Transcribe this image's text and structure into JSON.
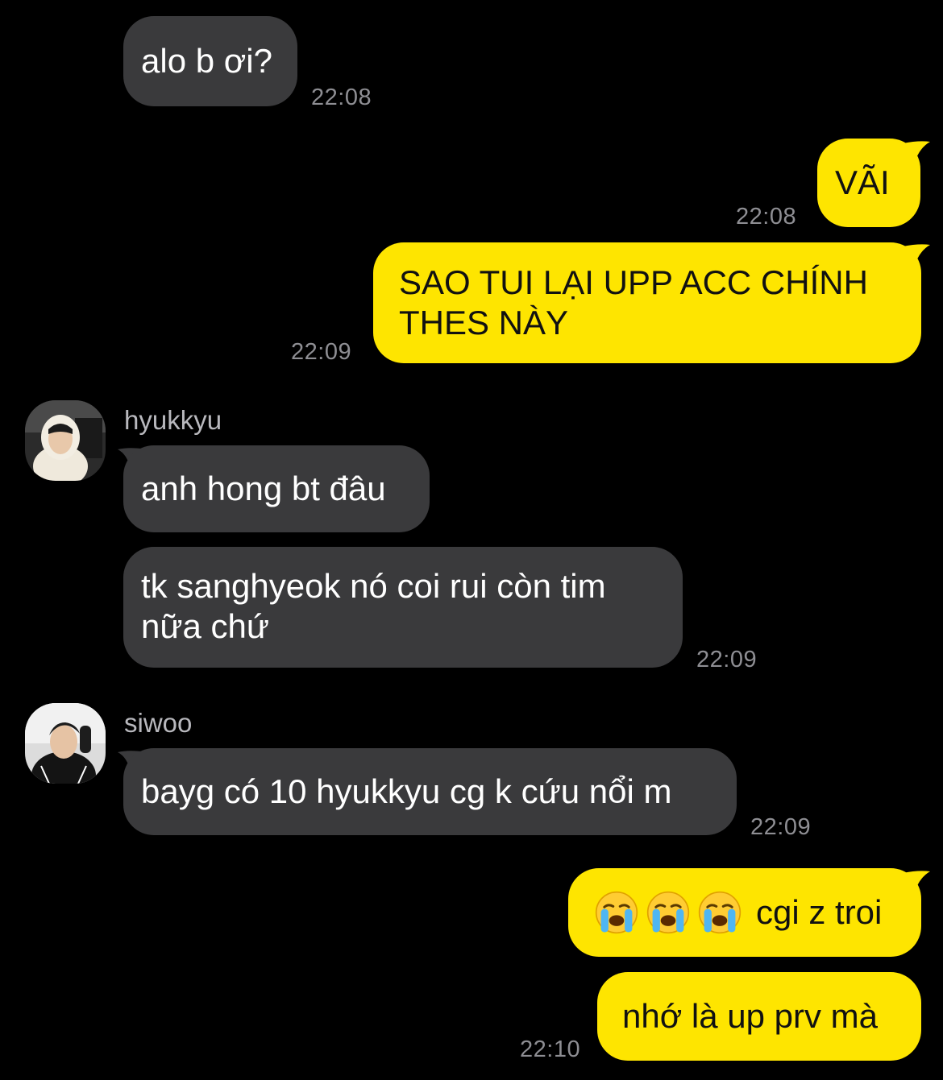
{
  "colors": {
    "background": "#000000",
    "incoming_bubble": "#3a3a3c",
    "outgoing_bubble": "#fee500",
    "timestamp": "#8e8e93",
    "sender_name": "#b8b8bd"
  },
  "messages": [
    {
      "id": "m1",
      "direction": "in",
      "text": "alo b ơi?",
      "time": "22:08"
    },
    {
      "id": "m2",
      "direction": "out",
      "text": "VÃI",
      "time": "22:08"
    },
    {
      "id": "m3",
      "direction": "out",
      "text": "SAO TUI LẠI UPP ACC CHÍNH THES NÀY",
      "time": "22:09"
    },
    {
      "id": "m4",
      "direction": "in",
      "sender": "hyukkyu",
      "avatar_icon": "profile-photo-hoodie",
      "text": "anh hong bt đâu"
    },
    {
      "id": "m5",
      "direction": "in",
      "text": "tk sanghyeok nó coi rui còn tim nữa chứ",
      "time": "22:09"
    },
    {
      "id": "m6",
      "direction": "in",
      "sender": "siwoo",
      "avatar_icon": "profile-photo-black-jacket",
      "text": "bayg có 10 hyukkyu cg k cứu nổi m",
      "time": "22:09"
    },
    {
      "id": "m7",
      "direction": "out",
      "emoji_icons": [
        "loudly-crying-face-icon",
        "loudly-crying-face-icon",
        "loudly-crying-face-icon"
      ],
      "text": "cgi z troi"
    },
    {
      "id": "m8",
      "direction": "out",
      "text": "nhớ là up prv mà",
      "time": "22:10"
    }
  ]
}
